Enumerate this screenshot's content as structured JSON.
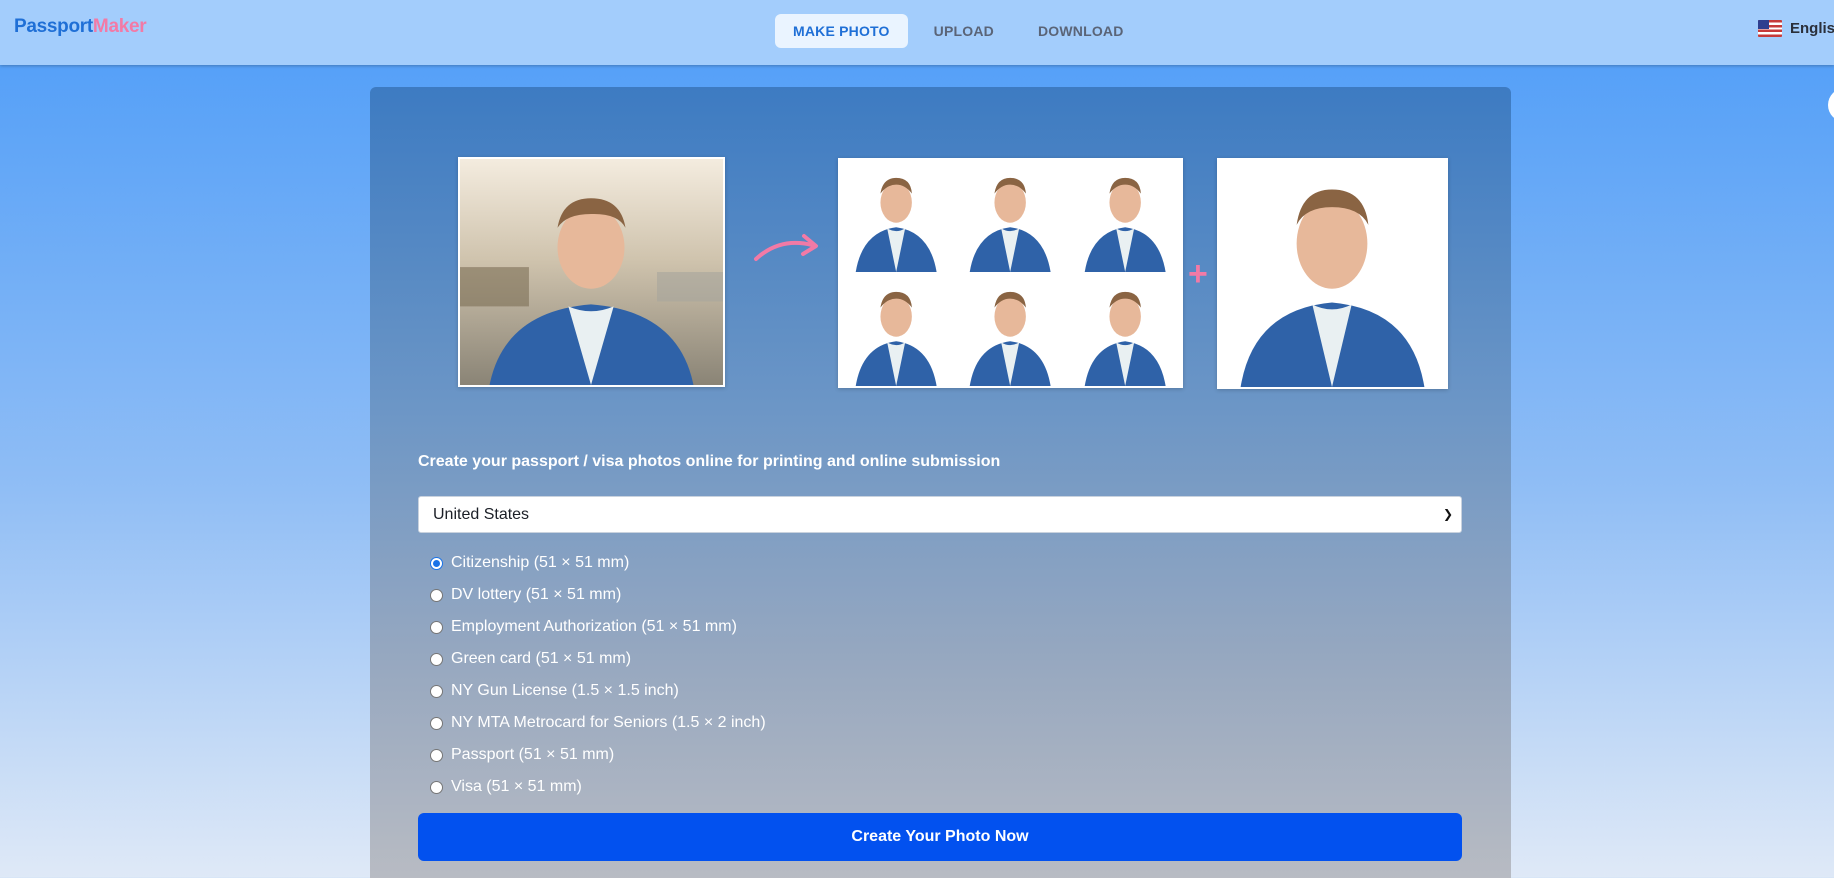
{
  "header": {
    "logo_part1": "Passport",
    "logo_part2": "Maker",
    "tabs": [
      {
        "label": "MAKE PHOTO",
        "active": true
      },
      {
        "label": "UPLOAD",
        "active": false
      },
      {
        "label": "DOWNLOAD",
        "active": false
      }
    ],
    "language": "English",
    "flag_icon": "us-flag-icon"
  },
  "hero": {
    "arrow_icon": "curved-arrow-icon",
    "plus_icon": "plus-icon",
    "accent_color": "#f27aa6"
  },
  "main": {
    "headline": "Create your passport / visa photos online for printing and online submission",
    "country_select": {
      "value": "United States"
    },
    "options": [
      {
        "label": "Citizenship (51 × 51 mm)",
        "selected": true
      },
      {
        "label": "DV lottery (51 × 51 mm)",
        "selected": false
      },
      {
        "label": "Employment Authorization (51 × 51 mm)",
        "selected": false
      },
      {
        "label": "Green card (51 × 51 mm)",
        "selected": false
      },
      {
        "label": "NY Gun License (1.5 × 1.5 inch)",
        "selected": false
      },
      {
        "label": "NY MTA Metrocard for Seniors (1.5 × 2 inch)",
        "selected": false
      },
      {
        "label": "Passport (51 × 51 mm)",
        "selected": false
      },
      {
        "label": "Visa (51 × 51 mm)",
        "selected": false
      }
    ],
    "cta_label": "Create Your Photo Now",
    "cta_color": "#0251ef"
  }
}
